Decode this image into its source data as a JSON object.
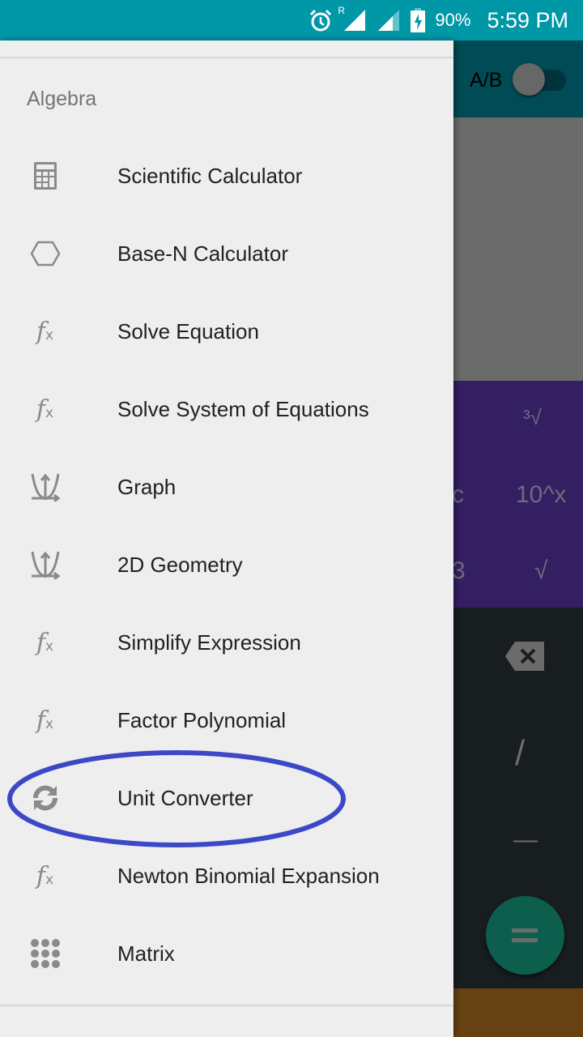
{
  "status_bar": {
    "battery": "90%",
    "time": "5:59 PM",
    "roaming": "R",
    "icons": [
      "alarm-icon",
      "signal-icon",
      "signal-icon",
      "battery-charging-icon"
    ]
  },
  "background_app": {
    "toggle_label": "A/B",
    "toggle_on": false,
    "keys": {
      "cube_root": "³√",
      "partial_c": "c",
      "ten_pow": "10^x",
      "partial_3": "3",
      "sqrt": "√",
      "divide": "/",
      "minus": "—"
    }
  },
  "drawer": {
    "section": "Algebra",
    "items": [
      {
        "label": "Scientific Calculator",
        "icon": "calculator-icon"
      },
      {
        "label": "Base-N Calculator",
        "icon": "hexagon-icon"
      },
      {
        "label": "Solve Equation",
        "icon": "function-icon"
      },
      {
        "label": "Solve System of Equations",
        "icon": "function-icon"
      },
      {
        "label": "Graph",
        "icon": "graph-icon"
      },
      {
        "label": "2D Geometry",
        "icon": "graph-icon"
      },
      {
        "label": "Simplify Expression",
        "icon": "function-icon"
      },
      {
        "label": "Factor Polynomial",
        "icon": "function-icon"
      },
      {
        "label": "Unit Converter",
        "icon": "refresh-icon",
        "highlighted": true
      },
      {
        "label": "Newton Binomial Expansion",
        "icon": "function-icon"
      },
      {
        "label": "Matrix",
        "icon": "grid-icon"
      }
    ]
  },
  "colors": {
    "status_bar": "#0097a7",
    "highlight": "#3c48c8"
  }
}
